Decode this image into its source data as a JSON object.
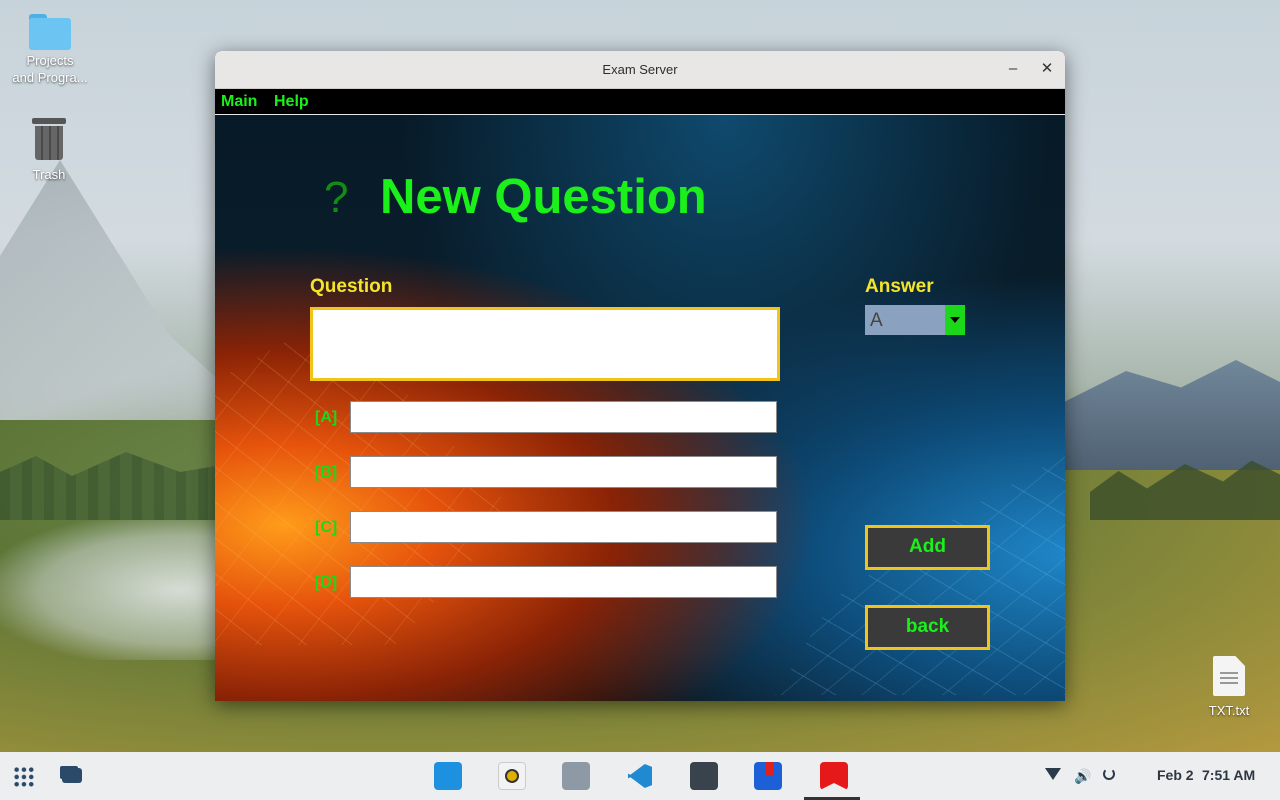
{
  "desktop": {
    "icons": [
      {
        "label": "Projects\nand Progra..."
      },
      {
        "label": "Trash"
      },
      {
        "label": "TXT.txt"
      }
    ]
  },
  "window": {
    "title": "Exam Server",
    "minimize_glyph": "–",
    "close_glyph": "✕"
  },
  "menu": {
    "items": [
      {
        "label": "Main"
      },
      {
        "label": "Help"
      }
    ]
  },
  "form": {
    "icon_glyph": "?",
    "heading": "New Question",
    "question_label": "Question",
    "question_value": "",
    "options": [
      {
        "label": "[A]",
        "value": ""
      },
      {
        "label": "[B]",
        "value": ""
      },
      {
        "label": "[C]",
        "value": ""
      },
      {
        "label": "[D]",
        "value": ""
      }
    ],
    "answer_label": "Answer",
    "answer_selected": "A",
    "add_label": "Add",
    "back_label": "back"
  },
  "taskbar": {
    "date": "Feb 2",
    "time": "7:51 AM",
    "apps": [
      "app-store-icon",
      "music-player-icon",
      "file-manager-icon",
      "vscode-icon",
      "terminal-icon",
      "book-reader-icon",
      "bookmark-app-icon"
    ]
  },
  "colors": {
    "accent_green": "#1bf01b",
    "label_yellow": "#f5e52a",
    "button_border": "#f2c41a"
  }
}
